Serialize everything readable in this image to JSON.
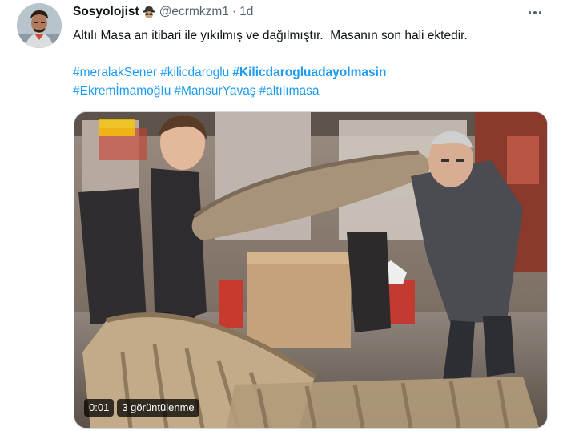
{
  "tweet": {
    "author_name": "Sosyolojist",
    "author_emoji": "spy-emoji",
    "handle": "@ecrmkzm1",
    "separator": "·",
    "time": "1d",
    "text": "Altılı Masa an itibari ile yıkılmış ve dağılmıştır.  Masanın son hali ektedir.",
    "hashtags_line1": [
      {
        "text": "#meralakSener",
        "bold": false
      },
      {
        "text": "#kilicdaroglu",
        "bold": false
      },
      {
        "text": "#Kilicdarogluadayolmasin",
        "bold": true
      }
    ],
    "hashtags_line2": [
      {
        "text": "#EkremİmamoğIu",
        "bold": false
      },
      {
        "text": "#MansurYavaş",
        "bold": false
      },
      {
        "text": "#altılımasa",
        "bold": false
      }
    ],
    "video": {
      "timestamp": "0:01",
      "views": "3 görüntülenme"
    }
  },
  "icons": {
    "more": "more-icon"
  },
  "colors": {
    "link": "#1d9bf0",
    "secondary": "#536471",
    "text": "#0f1419"
  }
}
